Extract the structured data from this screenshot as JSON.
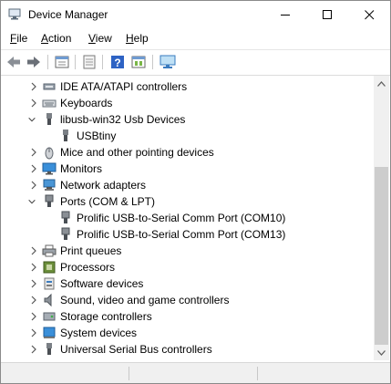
{
  "window": {
    "title": "Device Manager"
  },
  "menu": [
    {
      "label": "File",
      "mnemonic": "F",
      "rest": "ile"
    },
    {
      "label": "Action",
      "mnemonic": "A",
      "rest": "ction"
    },
    {
      "label": "View",
      "mnemonic": "V",
      "rest": "iew"
    },
    {
      "label": "Help",
      "mnemonic": "H",
      "rest": "elp"
    }
  ],
  "toolbar": {
    "buttons": [
      "back-icon",
      "forward-icon",
      "properties-icon",
      "update-driver-icon",
      "help-icon",
      "show-hidden-icon",
      "scan-hardware-icon"
    ]
  },
  "tree": {
    "items": [
      {
        "label": "IDE ATA/ATAPI controllers",
        "level": 0,
        "expanded": false,
        "icon": "ide-controller-icon"
      },
      {
        "label": "Keyboards",
        "level": 0,
        "expanded": false,
        "icon": "keyboard-icon"
      },
      {
        "label": "libusb-win32 Usb Devices",
        "level": 0,
        "expanded": true,
        "icon": "usb-plug-icon"
      },
      {
        "label": "USBtiny",
        "level": 1,
        "icon": "usb-plug-icon"
      },
      {
        "label": "Mice and other pointing devices",
        "level": 0,
        "expanded": false,
        "icon": "mouse-icon"
      },
      {
        "label": "Monitors",
        "level": 0,
        "expanded": false,
        "icon": "monitor-icon"
      },
      {
        "label": "Network adapters",
        "level": 0,
        "expanded": false,
        "icon": "network-adapter-icon"
      },
      {
        "label": "Ports (COM & LPT)",
        "level": 0,
        "expanded": true,
        "icon": "port-icon"
      },
      {
        "label": "Prolific USB-to-Serial Comm Port (COM10)",
        "level": 1,
        "icon": "port-icon"
      },
      {
        "label": "Prolific USB-to-Serial Comm Port (COM13)",
        "level": 1,
        "icon": "port-icon"
      },
      {
        "label": "Print queues",
        "level": 0,
        "expanded": false,
        "icon": "printer-icon"
      },
      {
        "label": "Processors",
        "level": 0,
        "expanded": false,
        "icon": "processor-icon"
      },
      {
        "label": "Software devices",
        "level": 0,
        "expanded": false,
        "icon": "software-device-icon"
      },
      {
        "label": "Sound, video and game controllers",
        "level": 0,
        "expanded": false,
        "icon": "speaker-icon"
      },
      {
        "label": "Storage controllers",
        "level": 0,
        "expanded": false,
        "icon": "storage-controller-icon"
      },
      {
        "label": "System devices",
        "level": 0,
        "expanded": false,
        "icon": "system-device-icon"
      },
      {
        "label": "Universal Serial Bus controllers",
        "level": 0,
        "expanded": false,
        "icon": "usb-controller-icon"
      }
    ]
  },
  "colors": {
    "accent": "#1e6fd9",
    "chrome": "#f0f0f0"
  }
}
